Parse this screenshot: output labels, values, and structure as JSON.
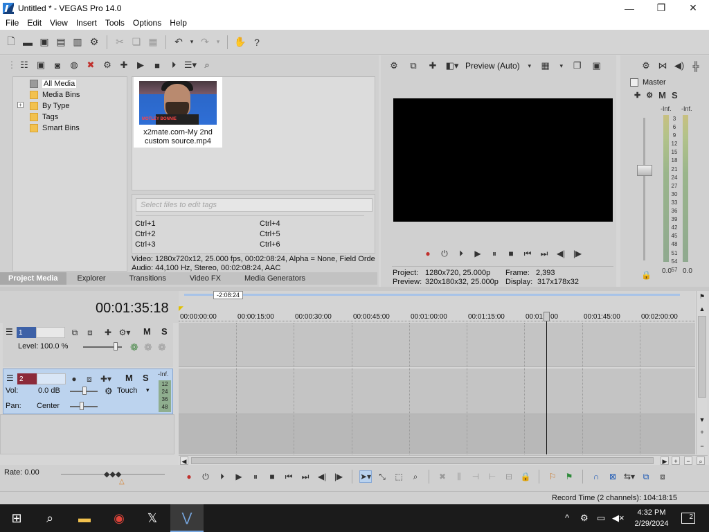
{
  "window": {
    "title": "Untitled * - VEGAS Pro 14.0",
    "controls": {
      "minimize": "—",
      "maximize": "❐",
      "close": "✕"
    }
  },
  "menu": [
    "File",
    "Edit",
    "View",
    "Insert",
    "Tools",
    "Options",
    "Help"
  ],
  "project_media": {
    "tree": {
      "all_media": "All Media",
      "media_bins": "Media Bins",
      "by_type": "By Type",
      "tags": "Tags",
      "smart_bins": "Smart Bins",
      "expander": "+"
    },
    "thumb_overlay_text": "MOTLEY BONNIE",
    "media_file": {
      "name_line1": "x2mate.com-My 2nd",
      "name_line2": "custom source.mp4"
    },
    "tag_placeholder": "Select files to edit tags",
    "shortcuts": [
      "Ctrl+1",
      "Ctrl+2",
      "Ctrl+3",
      "Ctrl+4",
      "Ctrl+5",
      "Ctrl+6"
    ],
    "info_video": "Video: 1280x720x12, 25.000 fps, 00:02:08:24, Alpha = None, Field Orde",
    "info_audio": "Audio: 44,100 Hz, Stereo, 00:02:08:24, AAC"
  },
  "tabs": [
    "Project Media",
    "Explorer",
    "Transitions",
    "Video FX",
    "Media Generators"
  ],
  "preview": {
    "quality": "Preview (Auto)",
    "project_label": "Project:",
    "project_value": "1280x720, 25.000p",
    "preview_label": "Preview:",
    "preview_value": "320x180x32, 25.000p",
    "frame_label": "Frame:",
    "frame_value": "2,393",
    "display_label": "Display:",
    "display_value": "317x178x32"
  },
  "master": {
    "title": "Master",
    "mute": "M",
    "solo": "S",
    "inf_left": "-Inf.",
    "inf_right": "-Inf.",
    "scale": [
      "3",
      "6",
      "9",
      "12",
      "15",
      "18",
      "21",
      "24",
      "27",
      "30",
      "33",
      "36",
      "39",
      "42",
      "45",
      "48",
      "51",
      "54",
      "57"
    ],
    "bottom_left": "0.0",
    "bottom_right": "0.0"
  },
  "timeline": {
    "time": "00:01:35:18",
    "region_length": "-2:08:24",
    "ruler": [
      "00:00:00:00",
      "00:00:15:00",
      "00:00:30:00",
      "00:00:45:00",
      "00:01:00:00",
      "00:01:15:00",
      "00:01:",
      "00",
      "00:01:45:00",
      "00:02:00:00"
    ],
    "track1": {
      "number": "1",
      "level_label": "Level:",
      "level_value": "100.0 %",
      "mute": "M",
      "solo": "S"
    },
    "track2": {
      "number": "2",
      "mute": "M",
      "solo": "S",
      "vol_label": "Vol:",
      "vol_value": "0.0 dB",
      "pan_label": "Pan:",
      "pan_value": "Center",
      "automation": "Touch",
      "meter_inf": "-Inf.",
      "meter_scale": [
        "12",
        "24",
        "36",
        "48"
      ]
    },
    "rate": "Rate: 0.00"
  },
  "status": {
    "record_time": "Record Time (2 channels): 104:18:15"
  },
  "taskbar": {
    "time": "4:32 PM",
    "date": "2/29/2024",
    "notifications": "2"
  }
}
